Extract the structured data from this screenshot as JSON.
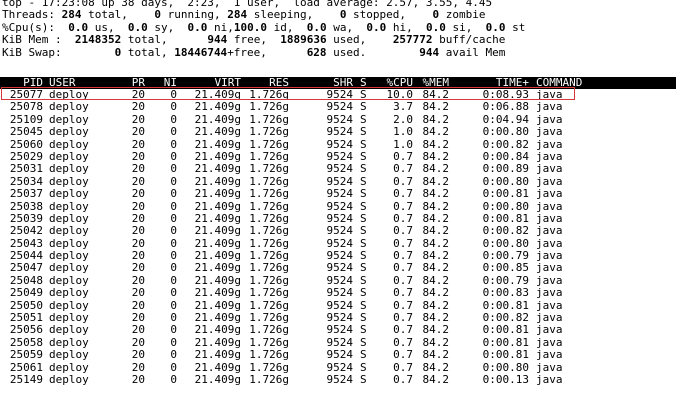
{
  "summary": {
    "line1": "top - 17:23:08 up 38 days,  2:23,  1 user,  load average: 2.57, 3.55, 4.45",
    "tasks": {
      "label": "Threads:",
      "total": "284",
      "total_label": " total,",
      "running": "0",
      "running_label": " running,",
      "sleeping": "284",
      "sleeping_label": " sleeping,",
      "stopped": "0",
      "stopped_label": " stopped,",
      "zombie": "0",
      "zombie_label": " zombie"
    },
    "cpu": {
      "label": "%Cpu(s):",
      "us": "0.0",
      "us_label": " us,",
      "sy": "0.0",
      "sy_label": " sy,",
      "ni": "0.0",
      "ni_label": " ni,",
      "id": "100.0",
      "id_label": " id,",
      "wa": "0.0",
      "wa_label": " wa,",
      "hi": "0.0",
      "hi_label": " hi,",
      "si": "0.0",
      "si_label": " si,",
      "st": "0.0",
      "st_label": " st"
    },
    "mem": {
      "label": "KiB Mem :",
      "total": "2148352",
      "total_label": " total,",
      "free": "944",
      "free_label": " free,",
      "used": "1889636",
      "used_label": " used,",
      "buff": "257772",
      "buff_label": " buff/cache"
    },
    "swap": {
      "label": "KiB Swap:",
      "total": "0",
      "total_label": " total,",
      "free": "18446744",
      "free_label": "+free,",
      "used": "628",
      "used_label": " used.",
      "avail": "944",
      "avail_label": " avail Mem"
    }
  },
  "columns": [
    "PID",
    "USER",
    "PR",
    "NI",
    "VIRT",
    "RES",
    "SHR",
    "S",
    "%CPU",
    "%MEM",
    "TIME+",
    "COMMAND"
  ],
  "rows": [
    [
      "25077",
      "deploy",
      "20",
      "0",
      "21.409g",
      "1.726g",
      "9524",
      "S",
      "10.0",
      "84.2",
      "0:08.93",
      "java"
    ],
    [
      "25078",
      "deploy",
      "20",
      "0",
      "21.409g",
      "1.726g",
      "9524",
      "S",
      "3.7",
      "84.2",
      "0:06.88",
      "java"
    ],
    [
      "25109",
      "deploy",
      "20",
      "0",
      "21.409g",
      "1.726g",
      "9524",
      "S",
      "2.0",
      "84.2",
      "0:04.94",
      "java"
    ],
    [
      "25045",
      "deploy",
      "20",
      "0",
      "21.409g",
      "1.726g",
      "9524",
      "S",
      "1.0",
      "84.2",
      "0:00.80",
      "java"
    ],
    [
      "25060",
      "deploy",
      "20",
      "0",
      "21.409g",
      "1.726g",
      "9524",
      "S",
      "1.0",
      "84.2",
      "0:00.82",
      "java"
    ],
    [
      "25029",
      "deploy",
      "20",
      "0",
      "21.409g",
      "1.726g",
      "9524",
      "S",
      "0.7",
      "84.2",
      "0:00.84",
      "java"
    ],
    [
      "25031",
      "deploy",
      "20",
      "0",
      "21.409g",
      "1.726g",
      "9524",
      "S",
      "0.7",
      "84.2",
      "0:00.89",
      "java"
    ],
    [
      "25034",
      "deploy",
      "20",
      "0",
      "21.409g",
      "1.726g",
      "9524",
      "S",
      "0.7",
      "84.2",
      "0:00.80",
      "java"
    ],
    [
      "25037",
      "deploy",
      "20",
      "0",
      "21.409g",
      "1.726g",
      "9524",
      "S",
      "0.7",
      "84.2",
      "0:00.81",
      "java"
    ],
    [
      "25038",
      "deploy",
      "20",
      "0",
      "21.409g",
      "1.726g",
      "9524",
      "S",
      "0.7",
      "84.2",
      "0:00.80",
      "java"
    ],
    [
      "25039",
      "deploy",
      "20",
      "0",
      "21.409g",
      "1.726g",
      "9524",
      "S",
      "0.7",
      "84.2",
      "0:00.81",
      "java"
    ],
    [
      "25042",
      "deploy",
      "20",
      "0",
      "21.409g",
      "1.726g",
      "9524",
      "S",
      "0.7",
      "84.2",
      "0:00.82",
      "java"
    ],
    [
      "25043",
      "deploy",
      "20",
      "0",
      "21.409g",
      "1.726g",
      "9524",
      "S",
      "0.7",
      "84.2",
      "0:00.80",
      "java"
    ],
    [
      "25044",
      "deploy",
      "20",
      "0",
      "21.409g",
      "1.726g",
      "9524",
      "S",
      "0.7",
      "84.2",
      "0:00.79",
      "java"
    ],
    [
      "25047",
      "deploy",
      "20",
      "0",
      "21.409g",
      "1.726g",
      "9524",
      "S",
      "0.7",
      "84.2",
      "0:00.85",
      "java"
    ],
    [
      "25048",
      "deploy",
      "20",
      "0",
      "21.409g",
      "1.726g",
      "9524",
      "S",
      "0.7",
      "84.2",
      "0:00.79",
      "java"
    ],
    [
      "25049",
      "deploy",
      "20",
      "0",
      "21.409g",
      "1.726g",
      "9524",
      "S",
      "0.7",
      "84.2",
      "0:00.83",
      "java"
    ],
    [
      "25050",
      "deploy",
      "20",
      "0",
      "21.409g",
      "1.726g",
      "9524",
      "S",
      "0.7",
      "84.2",
      "0:00.81",
      "java"
    ],
    [
      "25051",
      "deploy",
      "20",
      "0",
      "21.409g",
      "1.726g",
      "9524",
      "S",
      "0.7",
      "84.2",
      "0:00.82",
      "java"
    ],
    [
      "25056",
      "deploy",
      "20",
      "0",
      "21.409g",
      "1.726g",
      "9524",
      "S",
      "0.7",
      "84.2",
      "0:00.81",
      "java"
    ],
    [
      "25058",
      "deploy",
      "20",
      "0",
      "21.409g",
      "1.726g",
      "9524",
      "S",
      "0.7",
      "84.2",
      "0:00.81",
      "java"
    ],
    [
      "25059",
      "deploy",
      "20",
      "0",
      "21.409g",
      "1.726g",
      "9524",
      "S",
      "0.7",
      "84.2",
      "0:00.81",
      "java"
    ],
    [
      "25061",
      "deploy",
      "20",
      "0",
      "21.409g",
      "1.726g",
      "9524",
      "S",
      "0.7",
      "84.2",
      "0:00.80",
      "java"
    ],
    [
      "25149",
      "deploy",
      "20",
      "0",
      "21.409g",
      "1.726g",
      "9524",
      "S",
      "0.7",
      "84.2",
      "0:00.13",
      "java"
    ]
  ],
  "colors": {
    "highlight": "#d9383a",
    "header_bg": "#000000",
    "header_fg": "#ffffff"
  }
}
